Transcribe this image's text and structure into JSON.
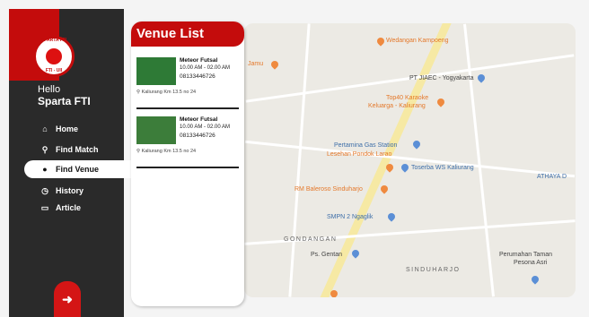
{
  "logo": {
    "top_text": "SPARTA FTI",
    "bottom_text": "FTI - UII"
  },
  "greeting": {
    "hello": "Hello",
    "user": "Sparta FTI"
  },
  "nav": [
    {
      "label": "Home",
      "icon": "home-icon"
    },
    {
      "label": "Find Match",
      "icon": "search-icon"
    },
    {
      "label": "Find Venue",
      "icon": "location-icon"
    },
    {
      "label": "History",
      "icon": "history-icon"
    },
    {
      "label": "Article",
      "icon": "book-icon"
    }
  ],
  "logout": {
    "icon": "logout-icon"
  },
  "venue_list": {
    "title": "Venue List",
    "items": [
      {
        "name": "Meteor Futsal",
        "hours": "10.00 AM - 02.00 AM",
        "phone": "08133446726",
        "address": "Kaliurang Km 13.5 no 24"
      },
      {
        "name": "Meteor Futsal",
        "hours": "10.00 AM - 02.00 AM",
        "phone": "08133446726",
        "address": "Kaliurang Km 13.5 no 24"
      }
    ]
  },
  "map": {
    "labels": [
      {
        "text": "Wedangan Kampoeng",
        "style": "orange"
      },
      {
        "text": "Jamu",
        "style": "orange"
      },
      {
        "text": "PT JIAEC - Yogyakarta",
        "style": "plain"
      },
      {
        "text": "Top40 Karaoke",
        "style": "orange"
      },
      {
        "text": "Keluarga - Kaliurang",
        "style": "orange"
      },
      {
        "text": "Pertamina Gas Station",
        "style": "blue"
      },
      {
        "text": "Lesehan Pondok Larao",
        "style": "orange"
      },
      {
        "text": "Toserba WS Kaliurang",
        "style": "blue"
      },
      {
        "text": "ATHAYA D",
        "style": "blue"
      },
      {
        "text": "RM Baleroso Sinduharjo",
        "style": "orange"
      },
      {
        "text": "SMPN 2 Ngaglik",
        "style": "blue"
      },
      {
        "text": "GONDANGAN",
        "style": "spaced"
      },
      {
        "text": "Ps. Gentan",
        "style": "plain"
      },
      {
        "text": "Perumahan Taman",
        "style": "plain"
      },
      {
        "text": "Pesona Asri",
        "style": "plain"
      },
      {
        "text": "SINDUHARJO",
        "style": "spaced"
      }
    ]
  },
  "colors": {
    "brand_red": "#c40c0c",
    "sidebar": "#2a2a2a"
  }
}
